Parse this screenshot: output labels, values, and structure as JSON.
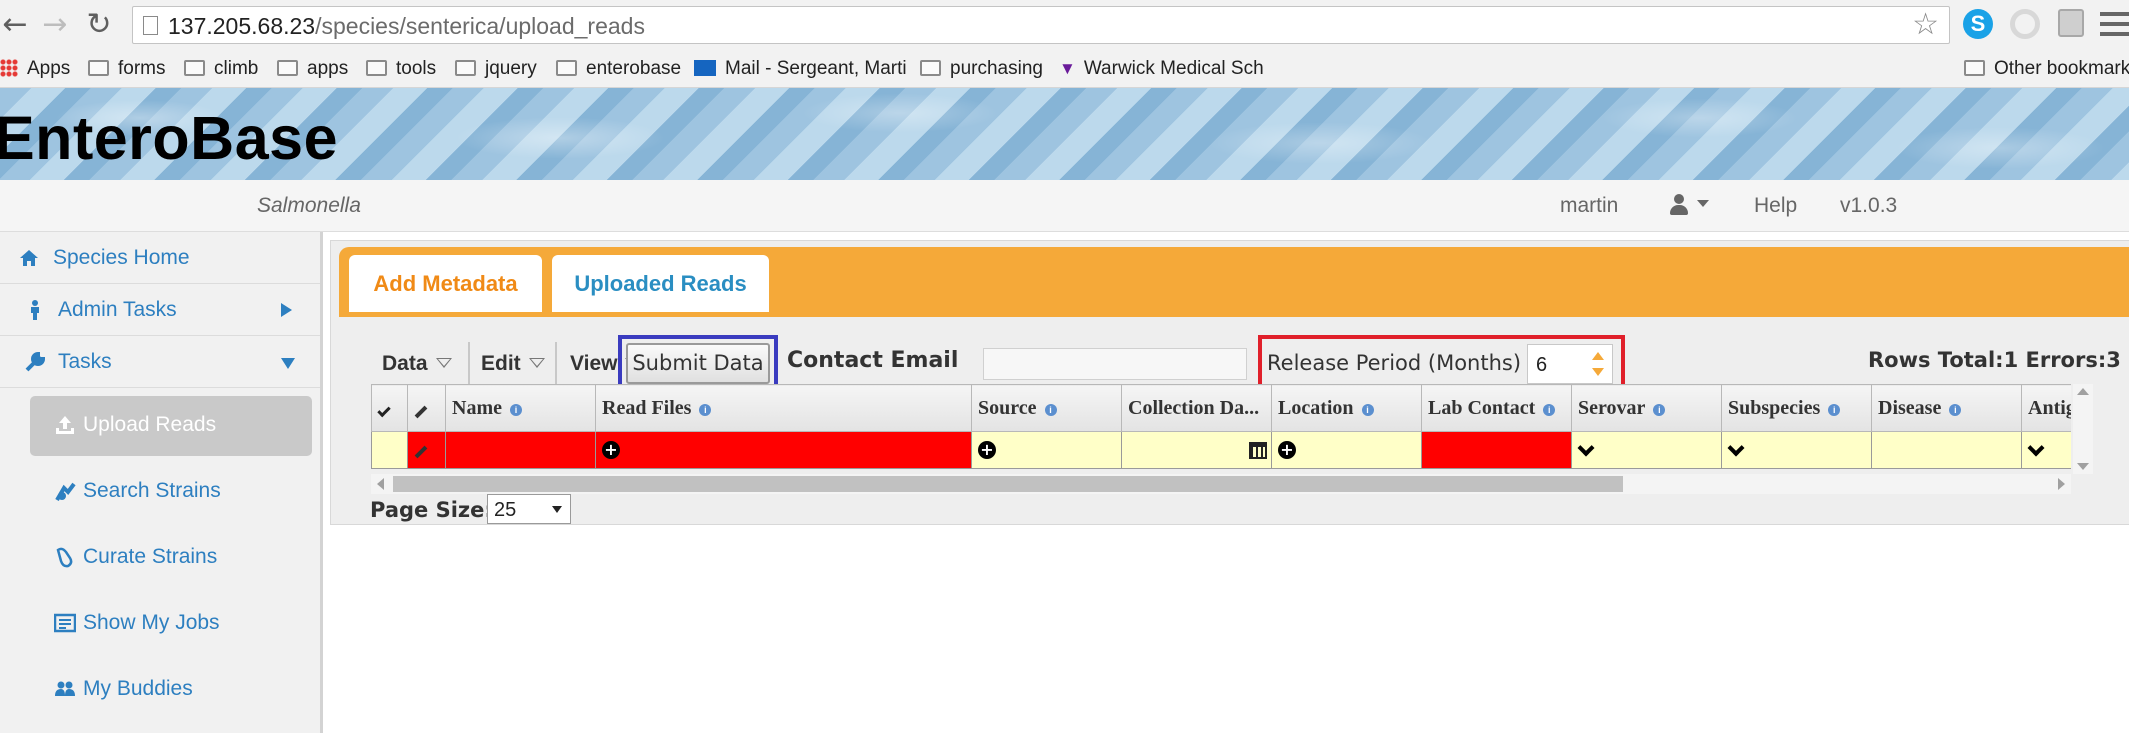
{
  "browser": {
    "url_host": "137.205.68.23",
    "url_path": "/species/senterica/upload_reads",
    "bookmarks": [
      {
        "label": "Apps",
        "icon": "apps-grid-icon"
      },
      {
        "label": "forms",
        "icon": "folder-icon"
      },
      {
        "label": "climb",
        "icon": "folder-icon"
      },
      {
        "label": "apps",
        "icon": "folder-icon"
      },
      {
        "label": "tools",
        "icon": "folder-icon"
      },
      {
        "label": "jquery",
        "icon": "folder-icon"
      },
      {
        "label": "enterobase",
        "icon": "folder-icon"
      },
      {
        "label": "Mail - Sergeant, Marti",
        "icon": "mail-icon"
      },
      {
        "label": "purchasing",
        "icon": "folder-icon"
      },
      {
        "label": "Warwick Medical Scho",
        "icon": "wms-icon"
      },
      {
        "label": "Other bookmarks",
        "icon": "folder-icon"
      }
    ]
  },
  "site": {
    "title": "EnteroBase",
    "species": "Salmonella",
    "user": "martin",
    "help": "Help",
    "version": "v1.0.3"
  },
  "sidebar": {
    "items": [
      {
        "label": "Species Home",
        "icon": "home-icon"
      },
      {
        "label": "Admin Tasks",
        "icon": "person-icon"
      },
      {
        "label": "Tasks",
        "icon": "wrench-icon"
      }
    ],
    "subitems": [
      {
        "label": "Upload Reads",
        "icon": "upload-icon",
        "active": true
      },
      {
        "label": "Search Strains",
        "icon": "search-strains-icon"
      },
      {
        "label": "Curate Strains",
        "icon": "curate-icon"
      },
      {
        "label": "Show My Jobs",
        "icon": "jobs-icon"
      },
      {
        "label": "My Buddies",
        "icon": "buddies-icon"
      }
    ]
  },
  "tabs": [
    {
      "label": "Add Metadata",
      "active": true
    },
    {
      "label": "Uploaded Reads",
      "active": false
    }
  ],
  "toolbar": {
    "data_menu": "Data",
    "edit_menu": "Edit",
    "view_menu": "View",
    "submit_label": "Submit Data",
    "contact_label": "Contact Email",
    "contact_value": "",
    "release_label": "Release Period (Months)",
    "release_value": "6",
    "rows_total": "Rows Total:1 Errors:3"
  },
  "table": {
    "columns": [
      "Name",
      "Read Files",
      "Source",
      "Collection Da...",
      "Location",
      "Lab Contact",
      "Serovar",
      "Subspecies",
      "Disease",
      "Antig"
    ]
  },
  "pagination": {
    "label": "Page Size:",
    "value": "25"
  },
  "colors": {
    "accent_orange": "#f5a939",
    "link_blue": "#2d7fc0",
    "error_red": "#ff0000",
    "cell_yellow": "#ffffc8",
    "highlight_blue": "#3a3bbf",
    "highlight_red": "#e01f2a"
  }
}
